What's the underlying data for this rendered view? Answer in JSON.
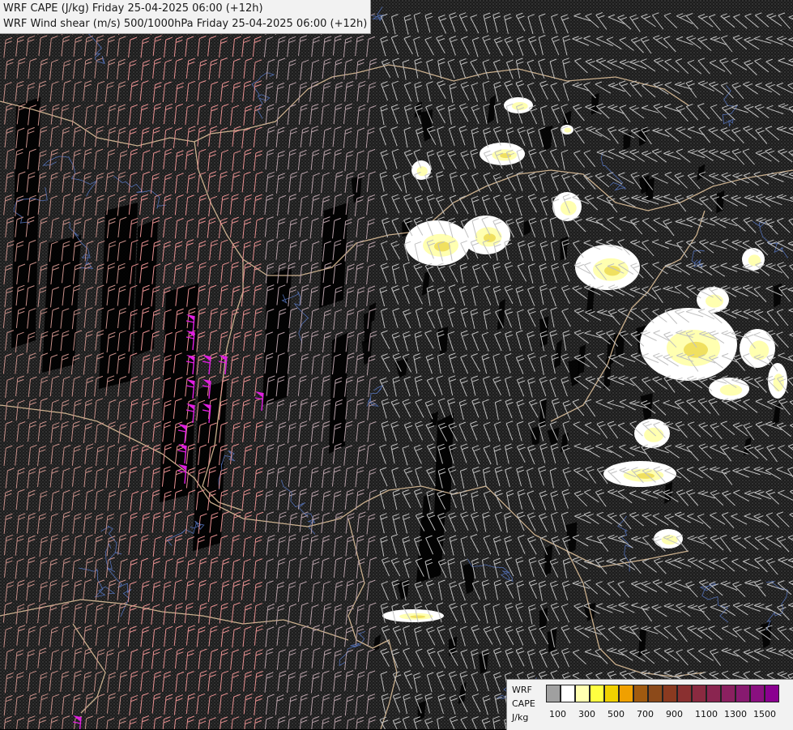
{
  "title": {
    "line1": "WRF CAPE (J/kg) Friday 25-04-2025 06:00 (+12h)",
    "line2": "WRF Wind shear (m/s) 500/1000hPa Friday 25-04-2025 06:00 (+12h)"
  },
  "legend": {
    "model": "WRF",
    "variable": "CAPE",
    "unit": "J/kg",
    "colors": [
      "#a0a0a0",
      "#ffffff",
      "#ffffb0",
      "#ffff40",
      "#f0d000",
      "#f0a000",
      "#a05a10",
      "#8c4a1a",
      "#8a3a20",
      "#8a3030",
      "#8a2a40",
      "#8a2550",
      "#8a2060",
      "#881a70",
      "#8a1080",
      "#8a0090"
    ],
    "tick_labels": [
      "100",
      "300",
      "500",
      "700",
      "900",
      "1100",
      "1300",
      "1500"
    ]
  },
  "map_layers": {
    "background": "#000000",
    "border_color": "#e8c8a0",
    "river_color": "#5a7ac8",
    "wind_barb_color_low": "#c0c0c0",
    "wind_barb_color_mid": "#e89090",
    "wind_barb_color_high": "#e020e0",
    "cape_colors": [
      "#ffffff",
      "#ffffb0",
      "#f0e060"
    ]
  }
}
